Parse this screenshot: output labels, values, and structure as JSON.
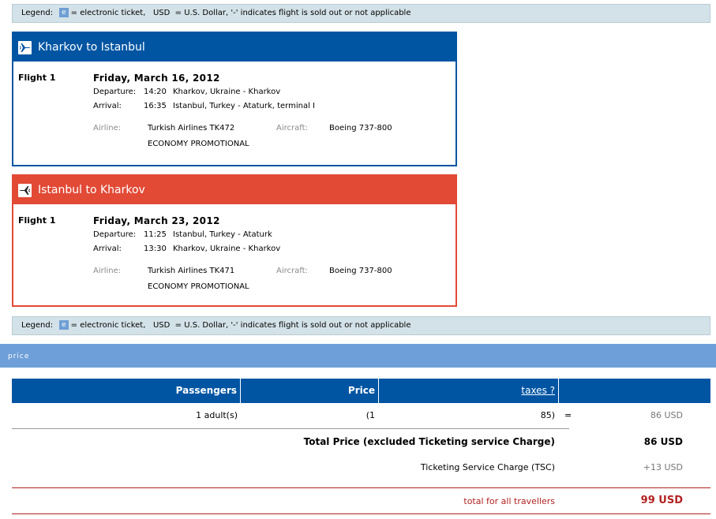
{
  "legend": {
    "label": "Legend:",
    "badge": "e",
    "text": "= electronic ticket,   USD  = U.S. Dollar, '-' indicates flight is sold out or not applicable"
  },
  "outbound": {
    "title": "Kharkov to Istanbul",
    "flight_label": "Flight 1",
    "date": "Friday, March 16, 2012",
    "departure_label": "Departure:",
    "departure_time": "14:20",
    "departure_place": "Kharkov, Ukraine - Kharkov",
    "arrival_label": "Arrival:",
    "arrival_time": "16:35",
    "arrival_place": "Istanbul, Turkey - Ataturk, terminal I",
    "airline_label": "Airline:",
    "airline": "Turkish Airlines TK472",
    "aircraft_label": "Aircraft:",
    "aircraft": "Boeing 737-800",
    "cabin": "ECONOMY PROMOTIONAL",
    "color": "#0055a3"
  },
  "return": {
    "title": "Istanbul to Kharkov",
    "flight_label": "Flight 1",
    "date": "Friday, March 23, 2012",
    "departure_label": "Departure:",
    "departure_time": "11:25",
    "departure_place": "Istanbul, Turkey - Ataturk",
    "arrival_label": "Arrival:",
    "arrival_time": "13:30",
    "arrival_place": "Kharkov, Ukraine - Kharkov",
    "airline_label": "Airline:",
    "airline": "Turkish Airlines TK471",
    "aircraft_label": "Aircraft:",
    "aircraft": "Boeing 737-800",
    "cabin": "ECONOMY PROMOTIONAL",
    "color": "#e24a36"
  },
  "price": {
    "section_title": "price",
    "headers": {
      "passengers": "Passengers",
      "price": "Price",
      "taxes": "taxes ?"
    },
    "row": {
      "passengers": "1 adult(s)",
      "price": "(1",
      "taxes": "85)",
      "equals": "=",
      "total": "86 USD"
    },
    "total_label": "Total Price (excluded Ticketing service Charge)",
    "total_value": "86 USD",
    "tsc_label": "Ticketing Service Charge (TSC)",
    "tsc_value": "+13 USD",
    "grand_label": "total for all travellers",
    "grand_value": "99 USD"
  }
}
